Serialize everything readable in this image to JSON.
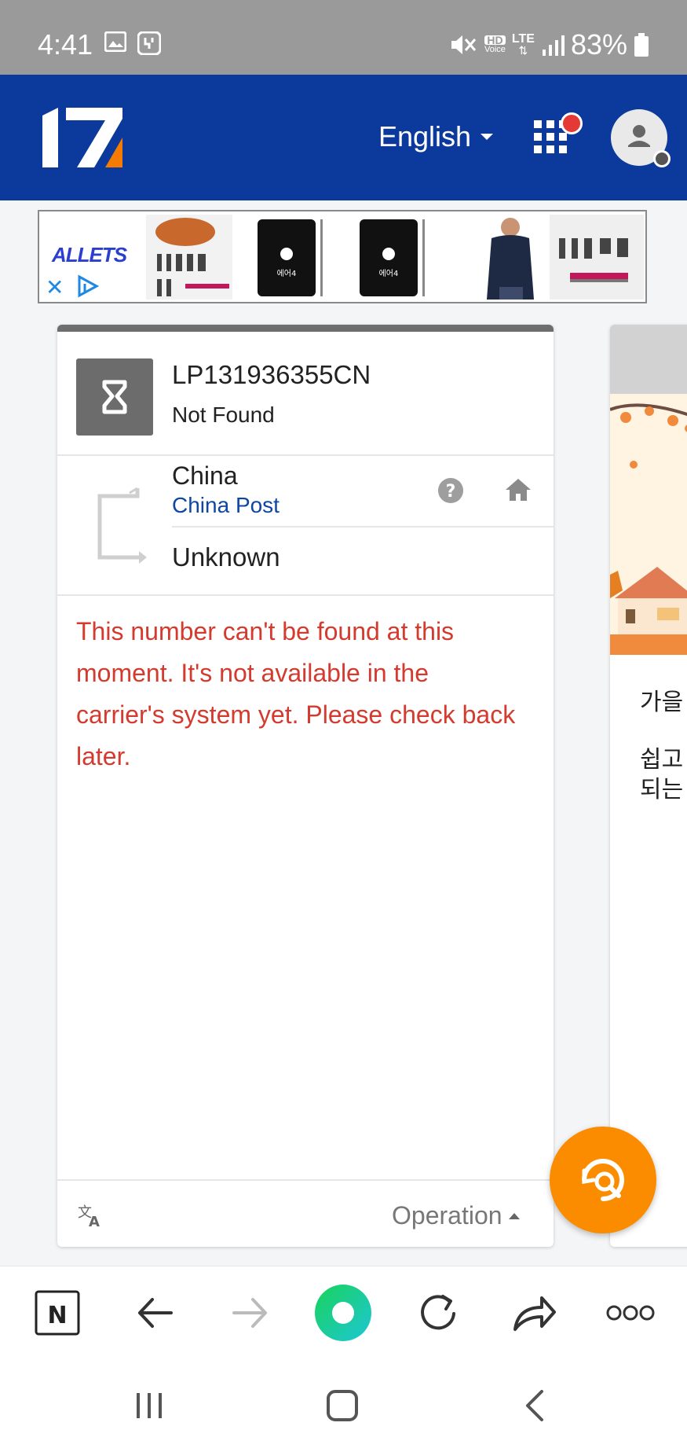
{
  "status_bar": {
    "time": "4:41",
    "battery": "83%",
    "hd_voice_label": "HD",
    "hd_voice_sub": "Voice",
    "lte_label": "LTE"
  },
  "header": {
    "logo_text": "17",
    "language": "English"
  },
  "ad": {
    "brand": "ALLETS",
    "device_label": "에어4"
  },
  "tracking_card": {
    "tracking_number": "LP131936355CN",
    "status": "Not Found",
    "origin_country": "China",
    "carrier": "China Post",
    "destination": "Unknown",
    "message": "This number can't be found at this moment. It's not available in the carrier's system yet. Please check back later.",
    "footer_operation": "Operation"
  },
  "side_card": {
    "line1": "가을",
    "line2": "쉽고",
    "line3": "되는"
  },
  "browser_toolbar": {
    "items": [
      "n-icon",
      "back-arrow-icon",
      "forward-arrow-icon",
      "home-circle-icon",
      "reload-icon",
      "share-icon",
      "more-icon"
    ]
  },
  "colors": {
    "header_bg": "#0b3a9c",
    "error_text": "#d43a2e",
    "fab": "#fb8c00",
    "carrier_link": "#0d47a1"
  }
}
